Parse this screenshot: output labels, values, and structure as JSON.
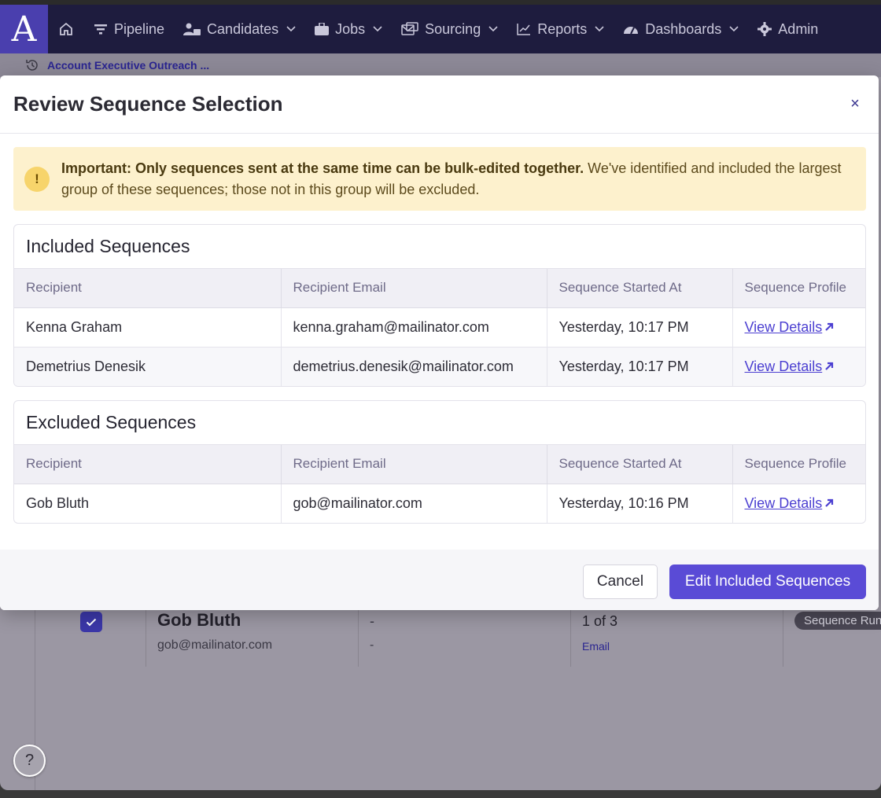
{
  "nav": {
    "logo": "A",
    "items": [
      {
        "label": "Pipeline",
        "icon": "funnel-icon",
        "has_dropdown": false
      },
      {
        "label": "Candidates",
        "icon": "people-icon",
        "has_dropdown": true
      },
      {
        "label": "Jobs",
        "icon": "briefcase-icon",
        "has_dropdown": true
      },
      {
        "label": "Sourcing",
        "icon": "sourcing-icon",
        "has_dropdown": true
      },
      {
        "label": "Reports",
        "icon": "chart-icon",
        "has_dropdown": true
      },
      {
        "label": "Dashboards",
        "icon": "gauge-icon",
        "has_dropdown": true
      },
      {
        "label": "Admin",
        "icon": "gear-icon",
        "has_dropdown": false
      }
    ]
  },
  "breadcrumb": {
    "label": "Account Executive Outreach ..."
  },
  "modal": {
    "title": "Review Sequence Selection",
    "close_label": "×",
    "alert": {
      "bold": "Important: Only sequences sent at the same time can be bulk-edited together.",
      "text": " We've identified and included the largest group of these sequences; those not in this group will be excluded."
    },
    "included": {
      "title": "Included Sequences",
      "columns": [
        "Recipient",
        "Recipient Email",
        "Sequence Started At",
        "Sequence Profile"
      ],
      "rows": [
        {
          "recipient": "Kenna Graham",
          "email": "kenna.graham@mailinator.com",
          "started": "Yesterday, 10:17 PM",
          "link": "View Details"
        },
        {
          "recipient": "Demetrius Denesik",
          "email": "demetrius.denesik@mailinator.com",
          "started": "Yesterday, 10:17 PM",
          "link": "View Details"
        }
      ]
    },
    "excluded": {
      "title": "Excluded Sequences",
      "columns": [
        "Recipient",
        "Recipient Email",
        "Sequence Started At",
        "Sequence Profile"
      ],
      "rows": [
        {
          "recipient": "Gob Bluth",
          "email": "gob@mailinator.com",
          "started": "Yesterday, 10:16 PM",
          "link": "View Details"
        }
      ]
    },
    "footer": {
      "cancel_label": "Cancel",
      "primary_label": "Edit Included Sequences"
    }
  },
  "background_row": {
    "name": "Gob Bluth",
    "email": "gob@mailinator.com",
    "dash1": "-",
    "dash2": "-",
    "step": "1 of 3",
    "channel": "Email",
    "status": "Sequence Running"
  },
  "help_label": "?",
  "colors": {
    "nav_bg": "#1e1c3e",
    "logo_bg": "#4a3fae",
    "primary": "#5a4bd6",
    "link": "#4b3fd1",
    "alert_bg": "#fdf1cd"
  }
}
